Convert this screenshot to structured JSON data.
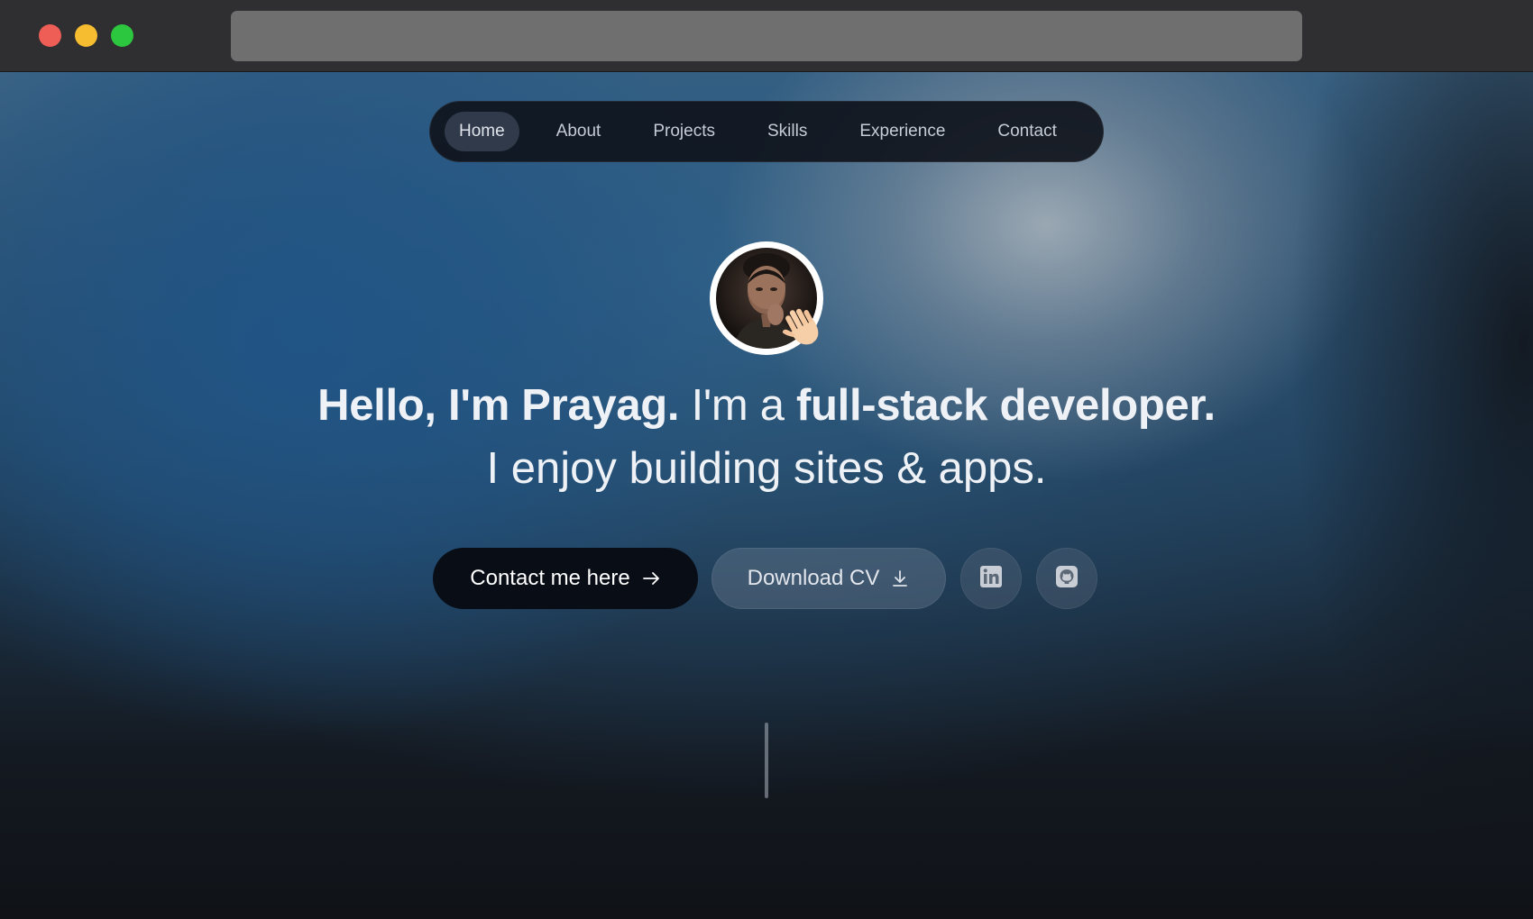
{
  "window": {
    "controls": [
      "close",
      "minimize",
      "maximize"
    ],
    "address_bar": ""
  },
  "nav": {
    "items": [
      {
        "label": "Home",
        "active": true
      },
      {
        "label": "About",
        "active": false
      },
      {
        "label": "Projects",
        "active": false
      },
      {
        "label": "Skills",
        "active": false
      },
      {
        "label": "Experience",
        "active": false
      },
      {
        "label": "Contact",
        "active": false
      }
    ]
  },
  "hero": {
    "avatar_icon": "profile-photo",
    "wave_icon": "waving-hand-icon",
    "line1_part1": "Hello, I'm Prayag.",
    "line1_part2": " I'm a ",
    "line1_part3": "full-stack developer.",
    "line2": "I enjoy building sites & apps."
  },
  "buttons": {
    "contact_label": "Contact me here",
    "contact_icon": "arrow-right-icon",
    "cv_label": "Download CV",
    "cv_icon": "download-icon",
    "linkedin_icon": "linkedin-icon",
    "github_icon": "github-icon"
  },
  "colors": {
    "primary_button": "#090d16",
    "nav_background": "#0e121a",
    "nav_active": "#313a4b",
    "text": "#eef1f5"
  }
}
